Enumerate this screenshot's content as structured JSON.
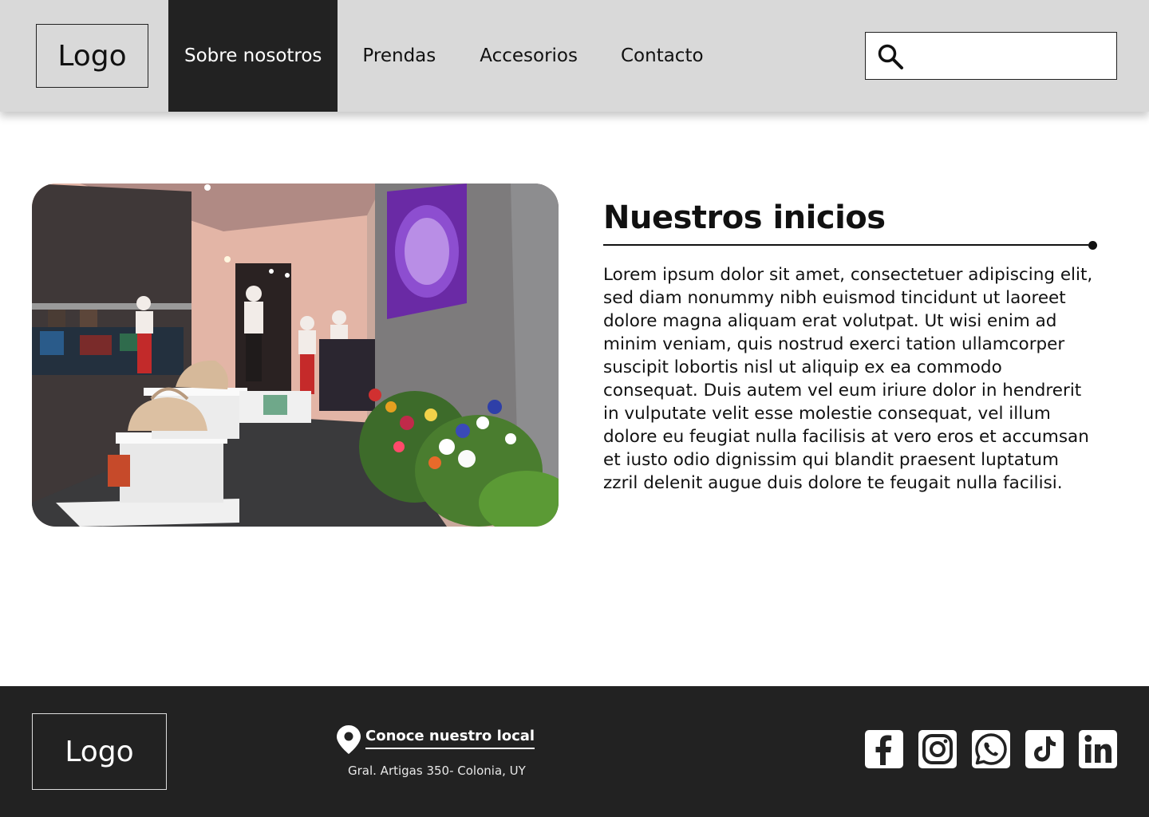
{
  "header": {
    "logo": "Logo",
    "nav": [
      {
        "label": "Sobre nosotros",
        "active": true
      },
      {
        "label": "Prendas",
        "active": false
      },
      {
        "label": "Accesorios",
        "active": false
      },
      {
        "label": "Contacto",
        "active": false
      }
    ],
    "search": {
      "icon": "search-icon",
      "value": "",
      "placeholder": ""
    }
  },
  "main": {
    "image": {
      "icon": "store-interior-photo"
    },
    "title": "Nuestros inicios",
    "body": "Lorem ipsum dolor sit amet, consectetuer adipiscing elit, sed diam nonummy nibh euismod tincidunt ut laoreet dolore magna aliquam erat volutpat. Ut wisi enim ad minim veniam, quis nostrud exerci tation ullamcorper suscipit lobortis nisl ut aliquip ex ea commodo consequat. Duis autem vel eum iriure dolor in hendrerit in vulputate velit esse molestie consequat, vel illum dolore eu feugiat nulla facilisis at vero eros et accumsan et iusto odio dignissim qui blandit praesent luptatum zzril delenit augue duis dolore te feugait nulla facilisi."
  },
  "footer": {
    "logo": "Logo",
    "location_icon": "map-pin-icon",
    "location_label": "Conoce nuestro local",
    "address": "Gral. Artigas 350- Colonia, UY",
    "socials": [
      "facebook-icon",
      "instagram-icon",
      "whatsapp-icon",
      "tiktok-icon",
      "linkedin-icon"
    ]
  },
  "colors": {
    "header_bg": "#d9d9d9",
    "dark": "#222222",
    "page_bg": "#ffffff",
    "text": "#111111"
  }
}
